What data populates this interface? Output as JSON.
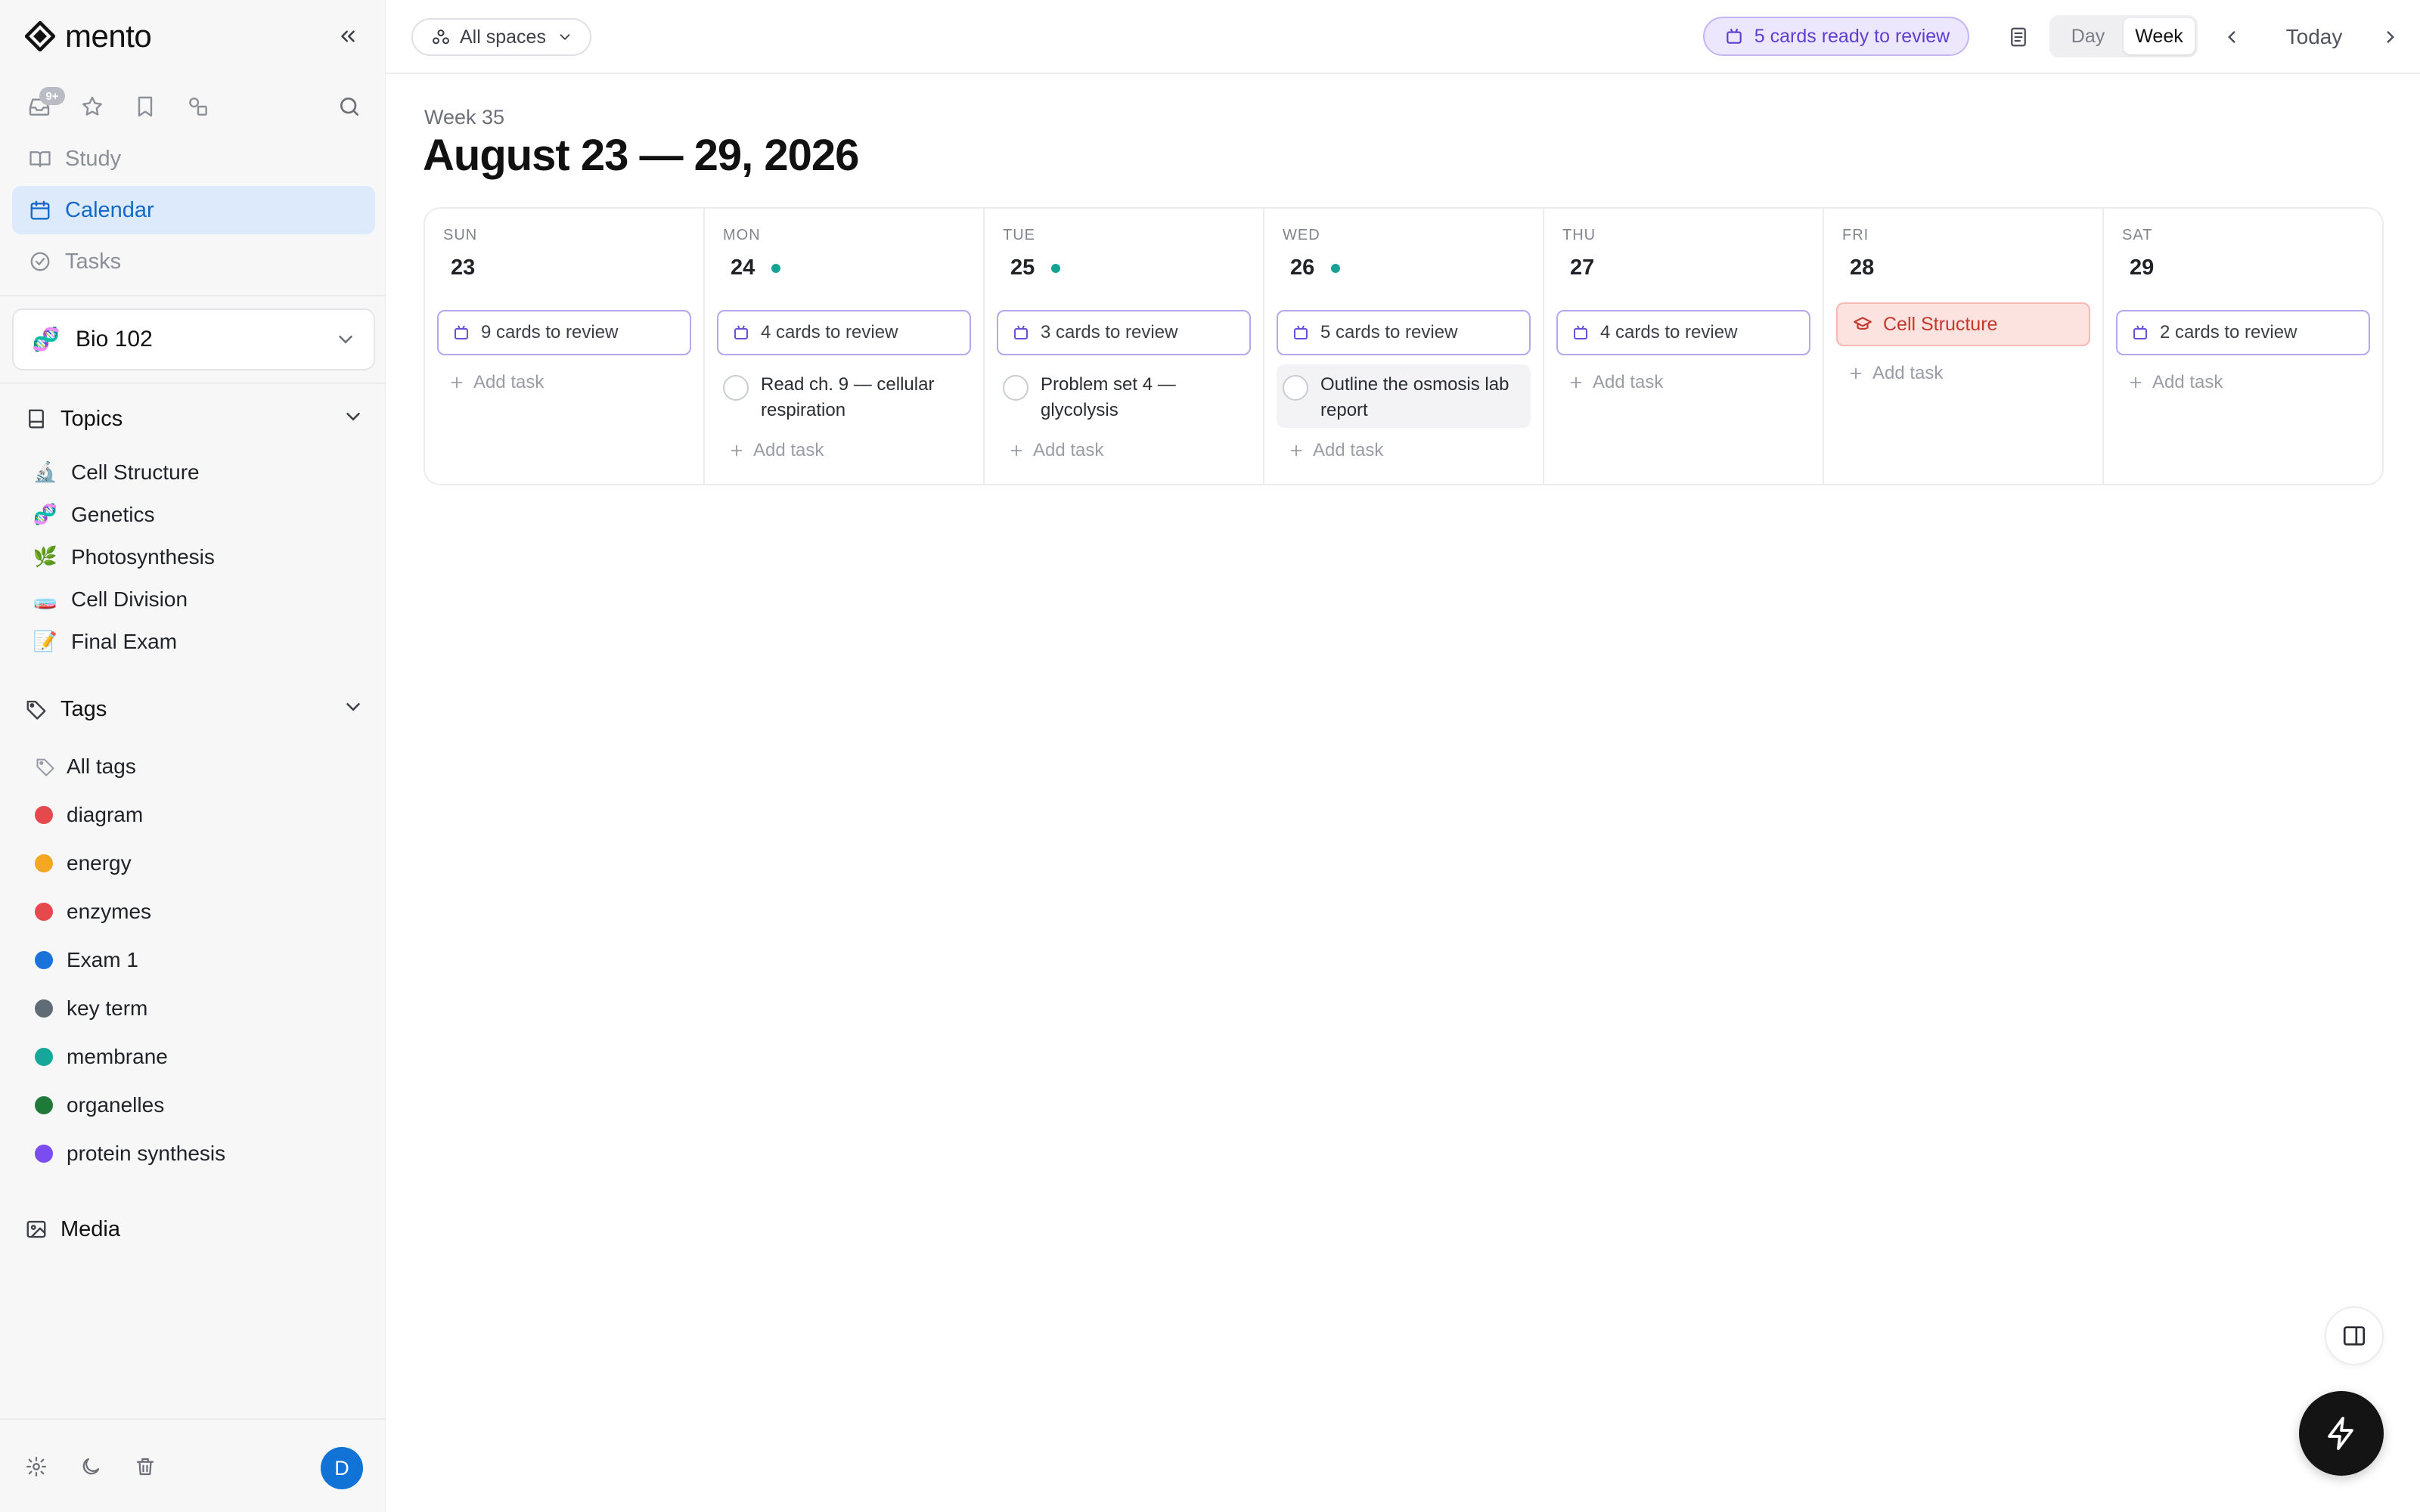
{
  "app": {
    "name": "mento"
  },
  "sidebar": {
    "badge": "9+",
    "nav": [
      {
        "label": "Study",
        "icon": "book-open-icon"
      },
      {
        "label": "Calendar",
        "icon": "calendar-icon",
        "active": true
      },
      {
        "label": "Tasks",
        "icon": "check-circle-icon"
      }
    ],
    "space": {
      "label": "Bio 102",
      "emoji": "🧬"
    },
    "topics_title": "Topics",
    "topics": [
      {
        "emoji": "🔬",
        "label": "Cell Structure"
      },
      {
        "emoji": "🧬",
        "label": "Genetics"
      },
      {
        "emoji": "🌿",
        "label": "Photosynthesis"
      },
      {
        "emoji": "🧫",
        "label": "Cell Division"
      },
      {
        "emoji": "📝",
        "label": "Final Exam"
      }
    ],
    "tags_title": "Tags",
    "all_tags": "All tags",
    "tags": [
      {
        "label": "diagram",
        "color": "#e5484d"
      },
      {
        "label": "energy",
        "color": "#f5a623"
      },
      {
        "label": "enzymes",
        "color": "#e5484d"
      },
      {
        "label": "Exam 1",
        "color": "#1a73d9"
      },
      {
        "label": "key term",
        "color": "#5f6b75"
      },
      {
        "label": "membrane",
        "color": "#17a79a"
      },
      {
        "label": "organelles",
        "color": "#1f7a3a"
      },
      {
        "label": "protein synthesis",
        "color": "#7b4df0"
      }
    ],
    "media_label": "Media",
    "avatar_initial": "D"
  },
  "header": {
    "spaces_label": "All spaces",
    "ready_label": "5 cards ready to review",
    "view_day": "Day",
    "view_week": "Week",
    "today_label": "Today"
  },
  "main": {
    "week_label": "Week 35",
    "range_title": "August 23 — 29, 2026",
    "add_task_label": "Add task",
    "days": [
      {
        "dow": "SUN",
        "num": "23",
        "dot": false,
        "review": "9 cards to review",
        "task": null
      },
      {
        "dow": "MON",
        "num": "24",
        "dot": true,
        "review": "4 cards to review",
        "task": "Read ch. 9 — cellular respiration"
      },
      {
        "dow": "TUE",
        "num": "25",
        "dot": true,
        "review": "3 cards to review",
        "task": "Problem set 4 — glycolysis"
      },
      {
        "dow": "WED",
        "num": "26",
        "dot": true,
        "review": "5 cards to review",
        "task": "Outline the osmosis lab report"
      },
      {
        "dow": "THU",
        "num": "27",
        "dot": false,
        "review": "4 cards to review",
        "task": null
      },
      {
        "dow": "FRI",
        "num": "28",
        "dot": false,
        "event": "Cell Structure",
        "task": null
      },
      {
        "dow": "SAT",
        "num": "29",
        "dot": false,
        "review": "2 cards to review",
        "task": null
      }
    ]
  },
  "colors": {
    "accent": "#1469c8",
    "review_border": "#b6a7ee",
    "task_dot": "#15a394",
    "event_text": "#c4382d"
  }
}
